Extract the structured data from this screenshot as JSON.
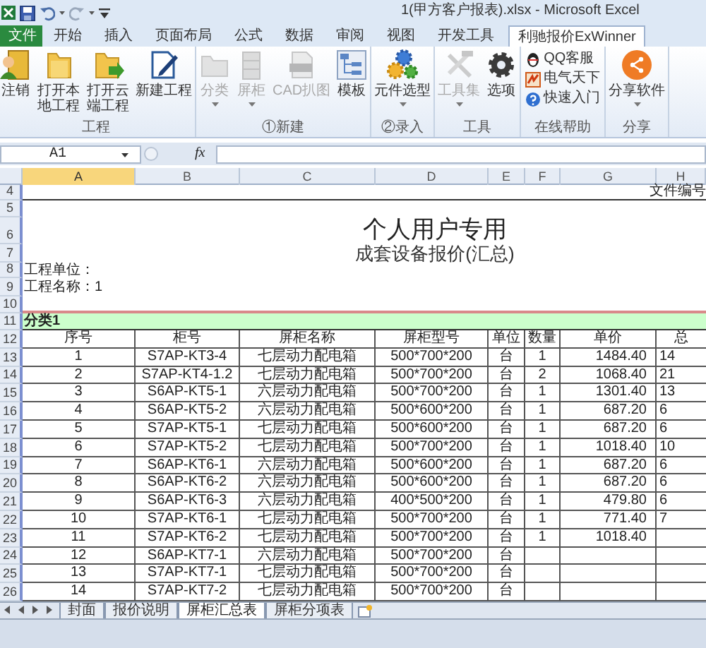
{
  "window": {
    "title": "1(甲方客户报表).xlsx - Microsoft Excel"
  },
  "ribbon": {
    "tabs": [
      {
        "label": "文件",
        "kind": "file",
        "selected": false
      },
      {
        "label": "开始",
        "kind": "tab",
        "selected": false
      },
      {
        "label": "插入",
        "kind": "tab",
        "selected": false
      },
      {
        "label": "页面布局",
        "kind": "tab",
        "selected": false
      },
      {
        "label": "公式",
        "kind": "tab",
        "selected": false
      },
      {
        "label": "数据",
        "kind": "tab",
        "selected": false
      },
      {
        "label": "审阅",
        "kind": "tab",
        "selected": false
      },
      {
        "label": "视图",
        "kind": "tab",
        "selected": false
      },
      {
        "label": "开发工具",
        "kind": "tab",
        "selected": false
      },
      {
        "label": "利驰报价ExWinner",
        "kind": "tab",
        "selected": true
      }
    ],
    "groups": [
      {
        "label": "工程",
        "buttons": [
          {
            "label": "注销",
            "kind": "large",
            "disabled": false,
            "dropdown": false
          },
          {
            "label": "打开本地工程",
            "kind": "large",
            "disabled": false,
            "dropdown": false
          },
          {
            "label": "打开云端工程",
            "kind": "large",
            "disabled": false,
            "dropdown": false
          },
          {
            "label": "新建工程",
            "kind": "large",
            "disabled": false,
            "dropdown": false
          }
        ]
      },
      {
        "label": "①新建",
        "buttons": [
          {
            "label": "分类",
            "kind": "large",
            "disabled": true,
            "dropdown": true
          },
          {
            "label": "屏柜",
            "kind": "large",
            "disabled": true,
            "dropdown": true
          },
          {
            "label": "CAD扒图",
            "kind": "large",
            "disabled": true,
            "dropdown": false
          },
          {
            "label": "模板",
            "kind": "large",
            "disabled": false,
            "dropdown": false
          }
        ]
      },
      {
        "label": "②录入",
        "buttons": [
          {
            "label": "元件选型",
            "kind": "large",
            "disabled": false,
            "dropdown": true
          }
        ]
      },
      {
        "label": "工具",
        "buttons": [
          {
            "label": "工具集",
            "kind": "large",
            "disabled": true,
            "dropdown": true
          },
          {
            "label": "选项",
            "kind": "large",
            "disabled": false,
            "dropdown": false
          }
        ]
      },
      {
        "label": "在线帮助",
        "buttons": [
          {
            "label": "QQ客服",
            "kind": "small",
            "disabled": false
          },
          {
            "label": "电气天下",
            "kind": "small",
            "disabled": false
          },
          {
            "label": "快速入门",
            "kind": "small",
            "disabled": false
          }
        ]
      },
      {
        "label": "分享",
        "buttons": [
          {
            "label": "分享软件",
            "kind": "large",
            "disabled": false,
            "dropdown": true
          }
        ]
      }
    ]
  },
  "formula_bar": {
    "name_box": "A1",
    "fx": "fx"
  },
  "sheet": {
    "columns": [
      {
        "label": "A",
        "selected": true
      },
      {
        "label": "B",
        "selected": false
      },
      {
        "label": "C",
        "selected": false
      },
      {
        "label": "D",
        "selected": false
      },
      {
        "label": "E",
        "selected": false
      },
      {
        "label": "F",
        "selected": false
      },
      {
        "label": "G",
        "selected": false
      },
      {
        "label": "H",
        "selected": false
      }
    ],
    "row_numbers": [
      "4",
      "5",
      "6",
      "7",
      "8",
      "9",
      "10",
      "11",
      "12",
      "13",
      "14",
      "15",
      "16",
      "17",
      "18",
      "19",
      "20",
      "21",
      "22",
      "23",
      "24",
      "25",
      "26"
    ],
    "file_number_label": "文件编号",
    "title": "个人用户专用",
    "subtitle": "成套设备报价(汇总)",
    "project_unit": "工程单位：",
    "project_name": "工程名称：1",
    "category": "分类1",
    "table": {
      "columns": [
        "序号",
        "柜号",
        "屏柜名称",
        "屏柜型号",
        "单位",
        "数量",
        "单价",
        "总"
      ],
      "rows": [
        [
          "1",
          "S7AP-KT3-4",
          "七层动力配电箱",
          "500*700*200",
          "台",
          "1",
          "1484.40",
          "14"
        ],
        [
          "2",
          "S7AP-KT4-1.2",
          "七层动力配电箱",
          "500*700*200",
          "台",
          "2",
          "1068.40",
          "21"
        ],
        [
          "3",
          "S6AP-KT5-1",
          "六层动力配电箱",
          "500*700*200",
          "台",
          "1",
          "1301.40",
          "13"
        ],
        [
          "4",
          "S6AP-KT5-2",
          "六层动力配电箱",
          "500*600*200",
          "台",
          "1",
          "687.20",
          "6"
        ],
        [
          "5",
          "S7AP-KT5-1",
          "七层动力配电箱",
          "500*600*200",
          "台",
          "1",
          "687.20",
          "6"
        ],
        [
          "6",
          "S7AP-KT5-2",
          "七层动力配电箱",
          "500*700*200",
          "台",
          "1",
          "1018.40",
          "10"
        ],
        [
          "7",
          "S6AP-KT6-1",
          "六层动力配电箱",
          "500*600*200",
          "台",
          "1",
          "687.20",
          "6"
        ],
        [
          "8",
          "S6AP-KT6-2",
          "六层动力配电箱",
          "500*600*200",
          "台",
          "1",
          "687.20",
          "6"
        ],
        [
          "9",
          "S6AP-KT6-3",
          "六层动力配电箱",
          "400*500*200",
          "台",
          "1",
          "479.80",
          "6"
        ],
        [
          "10",
          "S7AP-KT6-1",
          "七层动力配电箱",
          "500*700*200",
          "台",
          "1",
          "771.40",
          "7"
        ],
        [
          "11",
          "S7AP-KT6-2",
          "七层动力配电箱",
          "500*700*200",
          "台",
          "1",
          "1018.40",
          null
        ],
        [
          "12",
          "S6AP-KT7-1",
          "六层动力配电箱",
          "500*700*200",
          "台",
          null,
          null,
          null
        ],
        [
          "13",
          "S7AP-KT7-1",
          "七层动力配电箱",
          "500*700*200",
          "台",
          null,
          null,
          null
        ],
        [
          "14",
          "S7AP-KT7-2",
          "七层动力配电箱",
          "500*700*200",
          "台",
          null,
          null,
          null
        ]
      ]
    }
  },
  "sheet_tabs": [
    {
      "label": "封面",
      "selected": false
    },
    {
      "label": "报价说明",
      "selected": false
    },
    {
      "label": "屏柜汇总表",
      "selected": true
    },
    {
      "label": "屏柜分项表",
      "selected": false
    }
  ]
}
